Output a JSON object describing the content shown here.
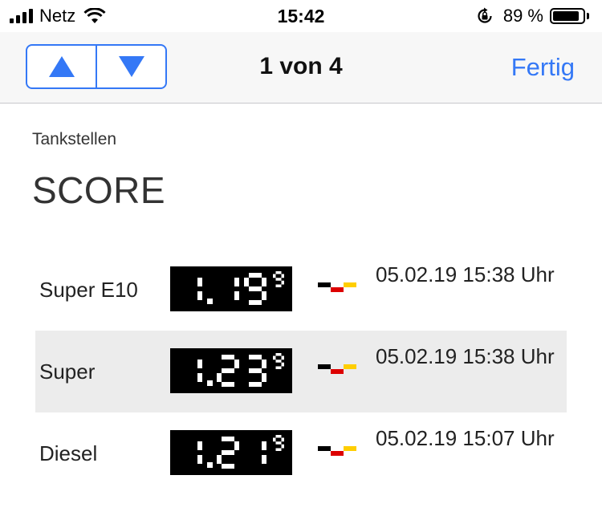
{
  "status_bar": {
    "carrier": "Netz",
    "time": "15:42",
    "battery": "89 %",
    "battery_level": 0.89
  },
  "nav": {
    "title": "1 von 4",
    "done_label": "Fertig",
    "up_icon": "triangle-up-icon",
    "down_icon": "triangle-down-icon"
  },
  "category": "Tankstellen",
  "station": "SCORE",
  "prices": [
    {
      "fuel": "Super E10",
      "price": "1.19",
      "sup": "9",
      "updated": "05.02.19 15:38 Uhr"
    },
    {
      "fuel": "Super",
      "price": "1.23",
      "sup": "9",
      "updated": "05.02.19 15:38 Uhr"
    },
    {
      "fuel": "Diesel",
      "price": "1.21",
      "sup": "9",
      "updated": "05.02.19 15:07 Uhr"
    }
  ],
  "colors": {
    "accent": "#3478f6",
    "flag_black": "#000000",
    "flag_red": "#dd0000",
    "flag_gold": "#ffce00"
  }
}
